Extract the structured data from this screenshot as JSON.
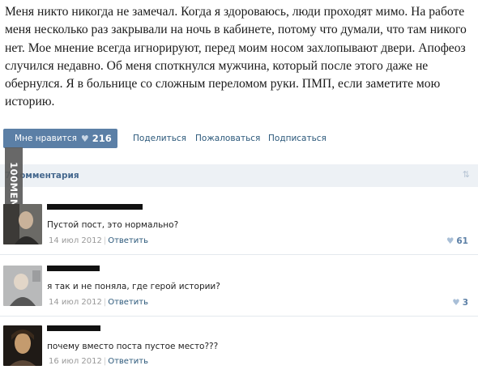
{
  "post": {
    "text": "Меня никто никогда не замечал. Когда я здороваюсь, люди проходят мимо. На работе меня несколько раз закрывали на ночь в кабинете, потому что думали, что там никого нет. Мое мнение всегда игнорируют, перед моим носом захлопывают двери. Апофеоз случился недавно. Об меня споткнулся мужчина, который после этого даже не обернулся. Я в больнице со сложным переломом руки. ПМП, если заметите мою историю."
  },
  "actions": {
    "like_label": "Мне нравится",
    "like_icon": "heart-icon",
    "like_count": "216",
    "share": "Поделиться",
    "report": "Пожаловаться",
    "subscribe": "Подписаться"
  },
  "comments_header": {
    "count_label": "7 комментария",
    "sort_icon": "sort-arrows-icon"
  },
  "watermark": "100MEM.RU",
  "comments": [
    {
      "text": "Пустой пост, это нормально?",
      "date": "14 июл 2012",
      "reply": "Ответить",
      "likes": "61"
    },
    {
      "text": "я так и не поняла, где герой истории?",
      "date": "14 июл 2012",
      "reply": "Ответить",
      "likes": "3"
    },
    {
      "text": "почему вместо поста пустое место???",
      "date": "16 июл 2012",
      "reply": "Ответить",
      "likes": ""
    }
  ],
  "colors": {
    "accent": "#5b7fa6",
    "link": "#2b587a",
    "comments_bar": "#edf1f5"
  }
}
